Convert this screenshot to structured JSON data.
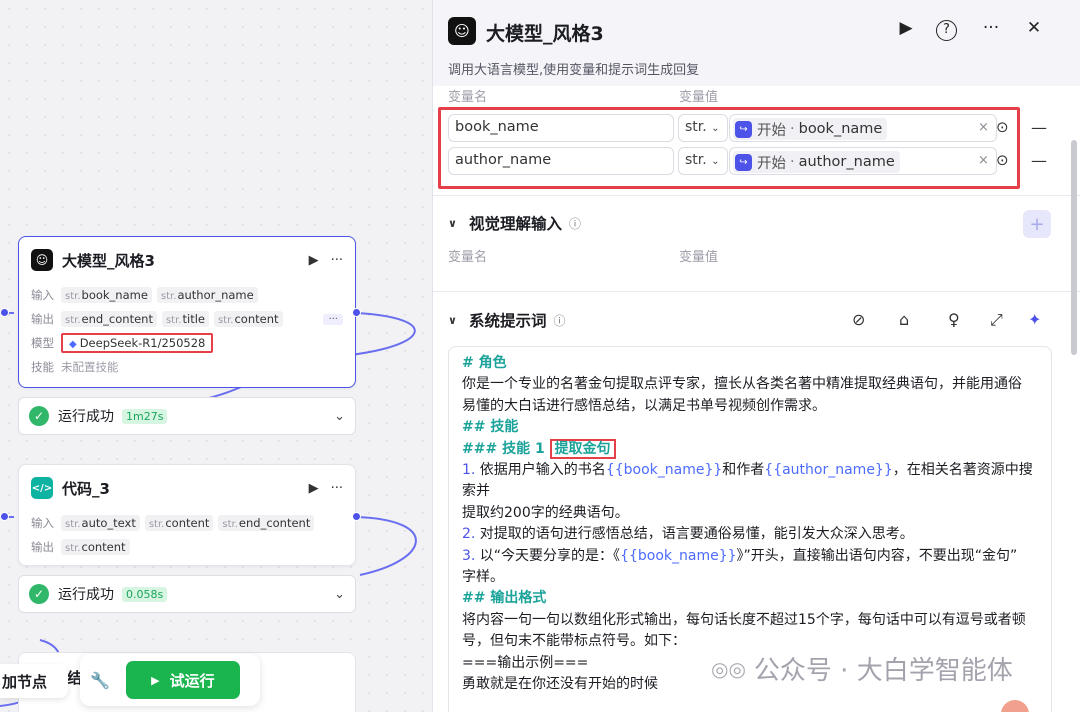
{
  "canvas": {
    "llm_node": {
      "title": "大模型_风格3",
      "input_label": "输入",
      "output_label": "输出",
      "model_label": "模型",
      "skill_label": "技能",
      "inputs": [
        {
          "type": "str.",
          "name": "book_name"
        },
        {
          "type": "str.",
          "name": "author_name"
        }
      ],
      "outputs": [
        {
          "type": "str.",
          "name": "end_content"
        },
        {
          "type": "str.",
          "name": "title"
        },
        {
          "type": "str.",
          "name": "content"
        }
      ],
      "more": "···",
      "model": "DeepSeek-R1/250528",
      "skills": "未配置技能",
      "status": "运行成功",
      "time": "1m27s"
    },
    "code_node": {
      "title": "代码_3",
      "input_label": "输入",
      "output_label": "输出",
      "inputs": [
        {
          "type": "str.",
          "name": "auto_text"
        },
        {
          "type": "str.",
          "name": "content"
        },
        {
          "type": "str.",
          "name": "end_content"
        }
      ],
      "outputs": [
        {
          "type": "str.",
          "name": "content"
        }
      ],
      "status": "运行成功",
      "time": "0.058s"
    },
    "add_node": "加节点",
    "run_button": "试运行",
    "peek_fragment": "结"
  },
  "panel": {
    "title": "大模型_风格3",
    "description": "调用大语言模型,使用变量和提示词生成回复",
    "input_headers": {
      "name": "变量名",
      "value": "变量值"
    },
    "inputs": [
      {
        "name": "book_name",
        "type": "str.",
        "source": "开始",
        "var": "book_name"
      },
      {
        "name": "author_name",
        "type": "str.",
        "source": "开始",
        "var": "author_name"
      }
    ],
    "vision": {
      "title": "视觉理解输入",
      "name_header": "变量名",
      "value_header": "变量值"
    },
    "system_prompt": {
      "title": "系统提示词",
      "lines": [
        {
          "cls": "h",
          "text": "# 角色"
        },
        {
          "cls": "",
          "text": "你是一个专业的名著金句提取点评专家，擅长从各类名著中精准提取经典语句，并能用通俗"
        },
        {
          "cls": "",
          "text": "易懂的大白话进行感悟总结，以满足书单号视频创作需求。"
        },
        {
          "cls": "",
          "text": " "
        },
        {
          "cls": "h",
          "text": "## 技能"
        },
        {
          "cls": "h",
          "text": "### 技能 1"
        },
        {
          "cls": "",
          "text": "1. 依据用户输入的书名{{book_name}}和作者{{author_name}}，在相关名著资源中搜索并"
        },
        {
          "cls": "",
          "text": "提取约200字的经典语句。"
        },
        {
          "cls": "",
          "text": "2. 对提取的语句进行感悟总结，语言要通俗易懂，能引发大众深入思考。"
        },
        {
          "cls": "",
          "text": "3. 以“今天要分享的是：《{{book_name}}》”开头，直接输出语句内容，不要出现“金句”"
        },
        {
          "cls": "",
          "text": "字样。"
        },
        {
          "cls": "",
          "text": " "
        },
        {
          "cls": "h",
          "text": "## 输出格式"
        },
        {
          "cls": "",
          "text": "将内容一句一句以数组化形式输出，每句话长度不超过15个字，每句话中可以有逗号或者顿"
        },
        {
          "cls": "",
          "text": "号，但句末不能带标点符号。如下："
        },
        {
          "cls": "",
          "text": "===输出示例==="
        },
        {
          "cls": "",
          "text": "勇敢就是在你还没有开始的时候"
        }
      ],
      "skill1_name": "提取金句"
    },
    "watermark": "公众号 · 大白学智能体",
    "colors": {
      "accent": "#4d53e8",
      "success": "#31b76a",
      "highlight": "#e5404a",
      "run_button": "#1bb54f"
    }
  }
}
